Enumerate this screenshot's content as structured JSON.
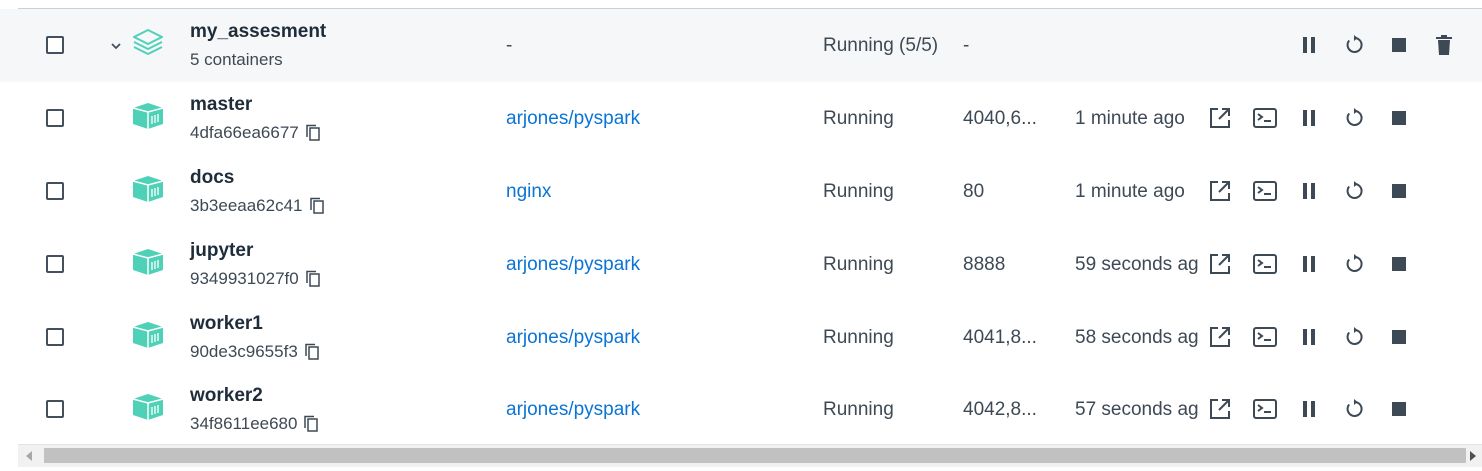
{
  "colors": {
    "accent": "#0b74d4",
    "container_icon": "#4fd1b7",
    "text": "#3d4955"
  },
  "group": {
    "name": "my_assesment",
    "subtitle": "5 containers",
    "image": "-",
    "status": "Running (5/5)",
    "ports": "-",
    "started": "",
    "icon": "layers-icon"
  },
  "containers": [
    {
      "name": "master",
      "id": "4dfa66ea6677",
      "image": "arjones/pyspark",
      "status": "Running",
      "ports": "4040,6...",
      "started": "1 minute ago"
    },
    {
      "name": "docs",
      "id": "3b3eeaa62c41",
      "image": "nginx",
      "status": "Running",
      "ports": "80",
      "started": "1 minute ago"
    },
    {
      "name": "jupyter",
      "id": "9349931027f0",
      "image": "arjones/pyspark",
      "status": "Running",
      "ports": "8888",
      "started": "59 seconds ag"
    },
    {
      "name": "worker1",
      "id": "90de3c9655f3",
      "image": "arjones/pyspark",
      "status": "Running",
      "ports": "4041,8...",
      "started": "58 seconds ag"
    },
    {
      "name": "worker2",
      "id": "34f8611ee680",
      "image": "arjones/pyspark",
      "status": "Running",
      "ports": "4042,8...",
      "started": "57 seconds ag"
    }
  ],
  "actions": {
    "group": [
      "pause-icon",
      "restart-icon",
      "stop-icon",
      "delete-icon"
    ],
    "container": [
      "open-in-browser-icon",
      "terminal-icon",
      "pause-icon",
      "restart-icon",
      "stop-icon"
    ]
  }
}
